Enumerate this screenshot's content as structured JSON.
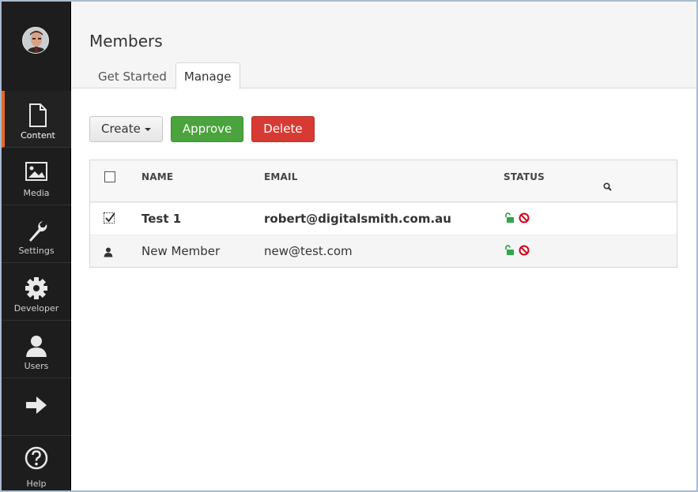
{
  "sidebar": {
    "items": [
      {
        "label": "Content",
        "icon": "document-icon",
        "active": true
      },
      {
        "label": "Media",
        "icon": "image-icon"
      },
      {
        "label": "Settings",
        "icon": "wrench-icon"
      },
      {
        "label": "Developer",
        "icon": "gear-icon"
      },
      {
        "label": "Users",
        "icon": "user-icon"
      },
      {
        "label": "",
        "icon": "arrow-right-icon"
      },
      {
        "label": "Help",
        "icon": "help-icon"
      }
    ]
  },
  "header": {
    "title": "Members",
    "tabs": [
      {
        "label": "Get Started"
      },
      {
        "label": "Manage",
        "active": true
      }
    ]
  },
  "toolbar": {
    "create_label": "Create",
    "approve_label": "Approve",
    "delete_label": "Delete"
  },
  "table": {
    "columns": [
      "NAME",
      "EMAIL",
      "STATUS"
    ],
    "rows": [
      {
        "name": "Test 1",
        "email": "robert@digitalsmith.com.au",
        "checked": true
      },
      {
        "name": "New Member",
        "email": "new@test.com",
        "checked": false
      }
    ]
  },
  "colors": {
    "sidebar_bg": "#1d1d1d",
    "active_accent": "#e2692a",
    "approve": "#4aa33c",
    "delete": "#d73a33",
    "unlock": "#2ea84a",
    "blocked": "#d0021b"
  }
}
